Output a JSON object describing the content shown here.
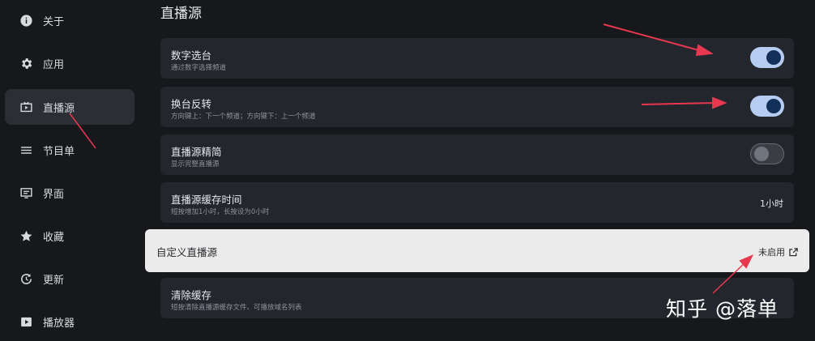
{
  "page_title": "直播源",
  "sidebar": {
    "items": [
      {
        "label": "关于",
        "icon": "info-icon"
      },
      {
        "label": "应用",
        "icon": "gear-icon"
      },
      {
        "label": "直播源",
        "icon": "live-tv-icon",
        "active": true
      },
      {
        "label": "节目单",
        "icon": "menu-list-icon"
      },
      {
        "label": "界面",
        "icon": "screen-icon"
      },
      {
        "label": "收藏",
        "icon": "star-icon"
      },
      {
        "label": "更新",
        "icon": "update-icon"
      },
      {
        "label": "播放器",
        "icon": "player-icon"
      }
    ]
  },
  "settings": [
    {
      "title": "数字选台",
      "subtitle": "通过数字选择频道",
      "control": "toggle",
      "enabled": true
    },
    {
      "title": "换台反转",
      "subtitle": "方向键上：下一个频道；方向键下：上一个频道",
      "control": "toggle",
      "enabled": true
    },
    {
      "title": "直播源精简",
      "subtitle": "显示完整直播源",
      "control": "toggle",
      "enabled": false
    },
    {
      "title": "直播源缓存时间",
      "subtitle": "短按增加1小时，长按设为0小时",
      "control": "value",
      "value": "1小时"
    },
    {
      "title": "自定义直播源",
      "control": "link",
      "value": "未启用",
      "icon": "external-link-icon",
      "focused": true
    },
    {
      "title": "清除缓存",
      "subtitle": "短按清除直播源缓存文件、可播放域名列表"
    }
  ],
  "watermark": "知乎 @落单",
  "colors": {
    "background": "#16181c",
    "card": "#23262c",
    "focused_card": "#ecebec",
    "toggle_on_track": "#b6ccf0",
    "toggle_on_knob": "#13305a",
    "annotation_arrow": "#e8384f"
  }
}
